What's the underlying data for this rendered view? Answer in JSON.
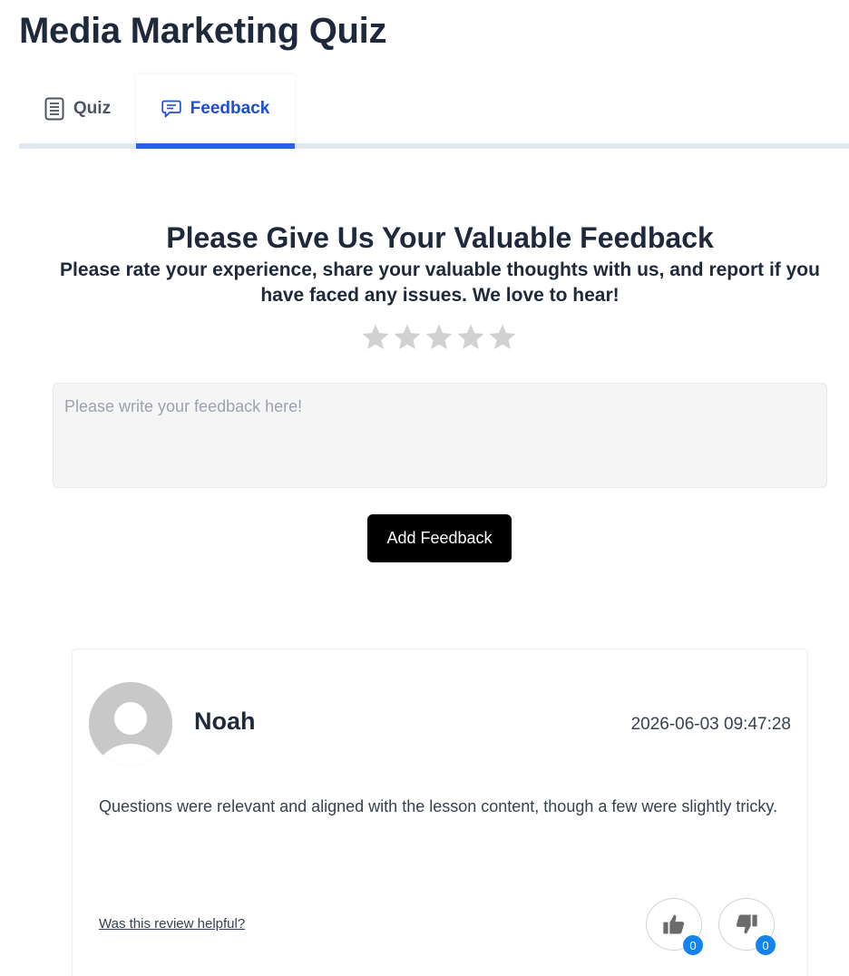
{
  "page_title": "Media Marketing Quiz",
  "tabs": [
    {
      "label": "Quiz",
      "icon": "document-icon",
      "active": false
    },
    {
      "label": "Feedback",
      "icon": "chat-bubble-icon",
      "active": true
    }
  ],
  "feedback": {
    "heading": "Please Give Us Your Valuable Feedback",
    "subheading": "Please rate your experience, share your valuable thoughts with us, and report if you have faced any issues. We love to hear!",
    "rating": 0,
    "rating_max": 5,
    "textarea_value": "",
    "textarea_placeholder": "Please write your feedback here!",
    "submit_label": "Add Feedback"
  },
  "reviews": [
    {
      "name": "Noah",
      "date": "2026-06-03 09:47:28",
      "text": "Questions were relevant and aligned with the lesson content, though a few were slightly tricky.",
      "helpful_prompt": "Was this review helpful?",
      "likes": "0",
      "dislikes": "0"
    }
  ],
  "colors": {
    "accent": "#2563eb",
    "active_tab_text": "#1d4ed8",
    "badge": "#1283f0",
    "star_empty": "#d1d1d1",
    "button_bg": "#000000"
  }
}
